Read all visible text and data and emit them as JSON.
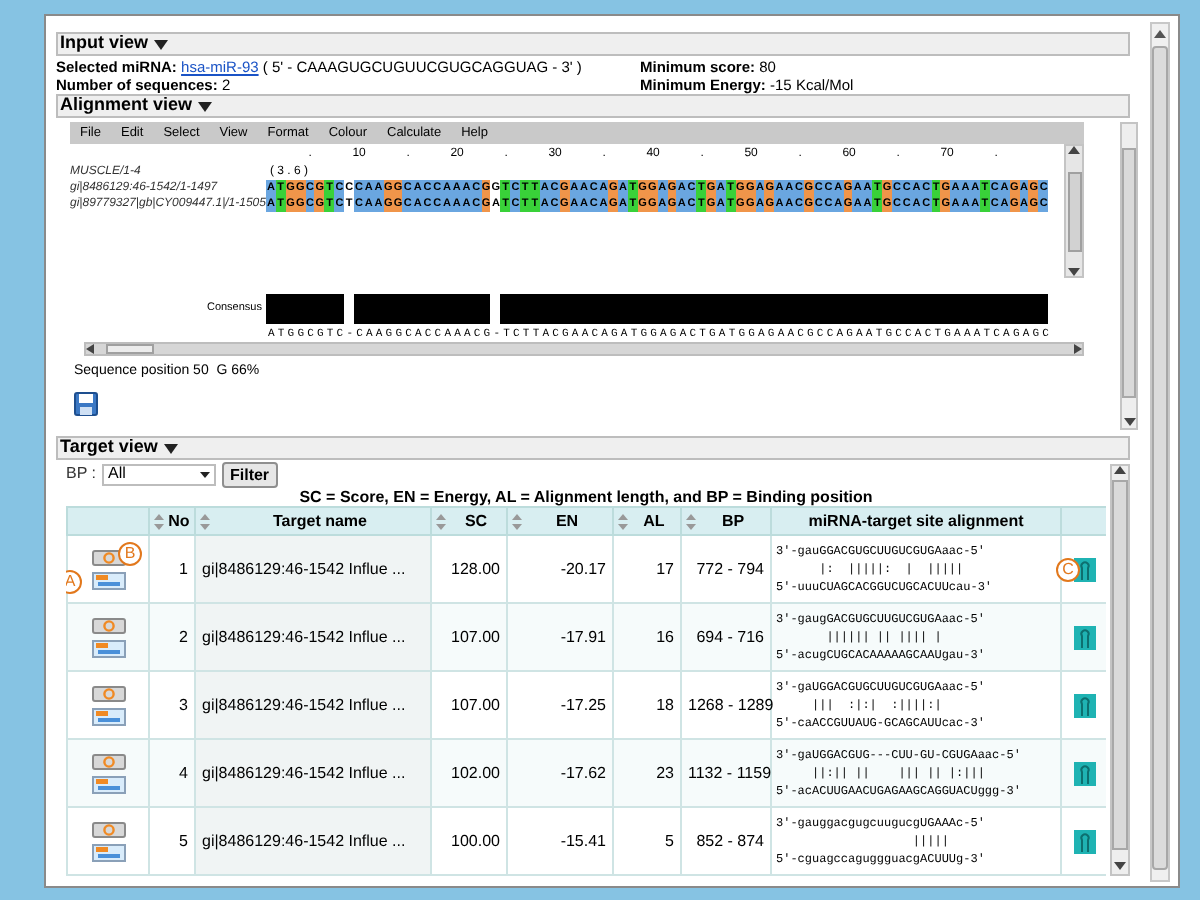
{
  "input_view": {
    "title": "Input view",
    "expanded": true,
    "selected_mirna": {
      "label": "Selected miRNA:",
      "link": "hsa-miR-93",
      "sequence": "( 5' - CAAAGUGCUGUUCGUGCAGGUAG - 3' )"
    },
    "sequence_count": {
      "label": "Number of sequences:",
      "value": "2"
    },
    "minimum_score": {
      "label": "Minimum score:",
      "value": "80"
    },
    "minimum_energy": {
      "label": "Minimum Energy:",
      "value": "-15 Kcal/Mol"
    }
  },
  "alignment_view": {
    "title": "Alignment view",
    "expanded": true,
    "menu": [
      "File",
      "Edit",
      "Select",
      "View",
      "Format",
      "Colour",
      "Calculate",
      "Help"
    ],
    "ruler": [
      ".",
      "10",
      ".",
      "20",
      ".",
      "30",
      ".",
      "40",
      ".",
      "50",
      ".",
      "60",
      ".",
      "70",
      "."
    ],
    "group_label": "MUSCLE/1-4",
    "group_note": "( 3 . 6 )",
    "sequences": [
      {
        "name": "gi|8486129:46-1542/1-1497",
        "residues": "ATGGCGTCCCAAGGCACCAAACGGTCTTACGAACAGATGGAGACTGATGGAGAACGCCAGAATGCCACTGAAATCAGAGC"
      },
      {
        "name": "gi|89779327|gb|CY009447.1|/1-1505",
        "residues": "ATGGCGTCTCAAGGCACCAAACGATCTTACGAACAGATGGAGACTGATGGAGAACGCCAGAATGCCACTGAAATCAGAGC"
      }
    ],
    "consensus": {
      "label": "Consensus",
      "residues": "ATGGCGTC-CAAGGCACCAAACG-TCTTACGAACAGATGGAGACTGATGGAGAACGCCAGAATGCCACTGAAATCAGAGC"
    },
    "status": "Sequence position 50  G 66%"
  },
  "target_view": {
    "title": "Target view",
    "expanded": true,
    "filter": {
      "label": "BP :",
      "value": "All",
      "button": "Filter"
    },
    "legend": "SC = Score, EN = Energy, AL = Alignment length, and BP = Binding position",
    "columns": [
      "No",
      "Target name",
      "SC",
      "EN",
      "AL",
      "BP",
      "miRNA-target site alignment"
    ],
    "rows": [
      {
        "no": "1",
        "target": "gi|8486129:46-1542 Influe ...",
        "sc": "128.00",
        "en": "-20.17",
        "al": "17",
        "bp": "772 - 794",
        "callouts": {
          "structure_icon": "A",
          "report_icon": "B",
          "hairpin_icon": "C"
        },
        "alignment": [
          "3'-gauGGACGUGCUUGUCGUGAaac-5'",
          "      |:  |||||:  |  |||||",
          "5'-uuuCUAGCACGGUCUGCACUUcau-3'"
        ]
      },
      {
        "no": "2",
        "target": "gi|8486129:46-1542 Influe ...",
        "sc": "107.00",
        "en": "-17.91",
        "al": "16",
        "bp": "694 - 716",
        "alignment": [
          "3'-gaugGACGUGCUUGUCGUGAaac-5'",
          "       |||||| || |||| |",
          "5'-acugCUGCACAAAAAGCAAUgau-3'"
        ]
      },
      {
        "no": "3",
        "target": "gi|8486129:46-1542 Influe ...",
        "sc": "107.00",
        "en": "-17.25",
        "al": "18",
        "bp": "1268 - 1289",
        "alignment": [
          "3'-gaUGGACGUGCUUGUCGUGAaac-5'",
          "     |||  :|:|  :||||:|",
          "5'-caACCGUUAUG-GCAGCAUUcac-3'"
        ]
      },
      {
        "no": "4",
        "target": "gi|8486129:46-1542 Influe ...",
        "sc": "102.00",
        "en": "-17.62",
        "al": "23",
        "bp": "1132 - 1159",
        "alignment": [
          "3'-gaUGGACGUG---CUU-GU-CGUGAaac-5'",
          "     ||:|| ||    ||| || |:|||",
          "5'-acACUUGAACUGAGAAGCAGGUACUggg-3'"
        ]
      },
      {
        "no": "5",
        "target": "gi|8486129:46-1542 Influe ...",
        "sc": "100.00",
        "en": "-15.41",
        "al": "5",
        "bp": "852 - 874",
        "alignment": [
          "3'-gauggacgugcuugucgUGAAAc-5'",
          "                   |||||",
          "5'-cguagccaguggguacgACUUUg-3'"
        ]
      }
    ]
  }
}
